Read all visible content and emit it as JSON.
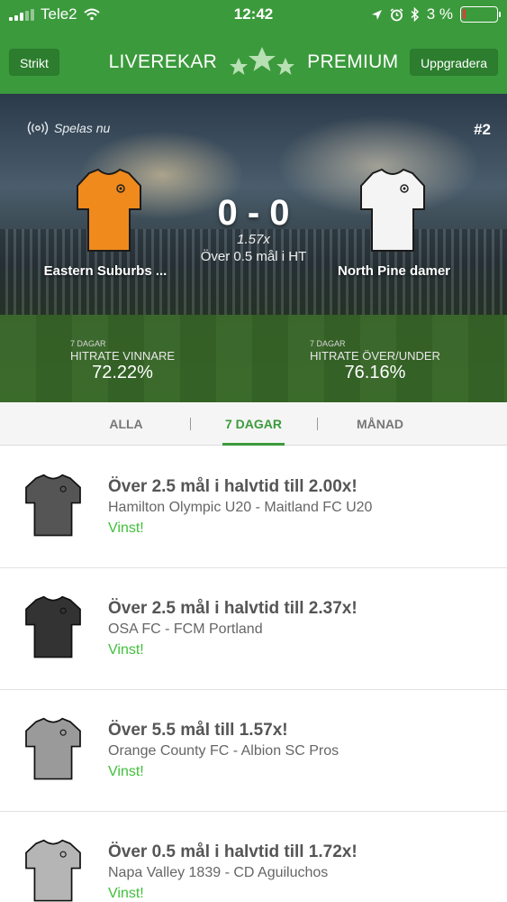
{
  "status_bar": {
    "carrier": "Tele2",
    "time": "12:42",
    "battery": "3 %"
  },
  "nav": {
    "left_button": "Strikt",
    "brand_left": "LIVEREKAR",
    "brand_right": "PREMIUM",
    "right_button": "Uppgradera"
  },
  "hero": {
    "live_label": "Spelas nu",
    "match_number": "#2",
    "home_team": "Eastern Suburbs ...",
    "away_team": "North Pine damer",
    "home_shirt_color": "#f08a1c",
    "away_shirt_color": "#f4f4f4",
    "score": "0 - 0",
    "odds": "1.57x",
    "tip": "Över 0.5 mål i HT",
    "stats": [
      {
        "period": "7 DAGAR",
        "title": "HITRATE VINNARE",
        "value": "72.22%"
      },
      {
        "period": "7 DAGAR",
        "title": "HITRATE ÖVER/UNDER",
        "value": "76.16%"
      }
    ]
  },
  "tabs": [
    {
      "label": "ALLA",
      "active": false
    },
    {
      "label": "7 DAGAR",
      "active": true
    },
    {
      "label": "MÅNAD",
      "active": false
    }
  ],
  "tips": [
    {
      "title": "Över 2.5 mål i halvtid till 2.00x!",
      "match": "Hamilton Olympic U20 - Maitland FC U20",
      "result": "Vinst!",
      "shirt_color": "#555555"
    },
    {
      "title": "Över 2.5 mål i halvtid till 2.37x!",
      "match": "OSA FC - FCM Portland",
      "result": "Vinst!",
      "shirt_color": "#333333"
    },
    {
      "title": "Över 5.5 mål till 1.57x!",
      "match": "Orange County FC - Albion SC Pros",
      "result": "Vinst!",
      "shirt_color": "#9a9a9a"
    },
    {
      "title": "Över 0.5 mål i halvtid till 1.72x!",
      "match": "Napa Valley 1839 - CD Aguiluchos",
      "result": "Vinst!",
      "shirt_color": "#b5b5b5"
    }
  ],
  "colors": {
    "brand_green": "#3b9a3c",
    "win_green": "#3fc03a"
  }
}
